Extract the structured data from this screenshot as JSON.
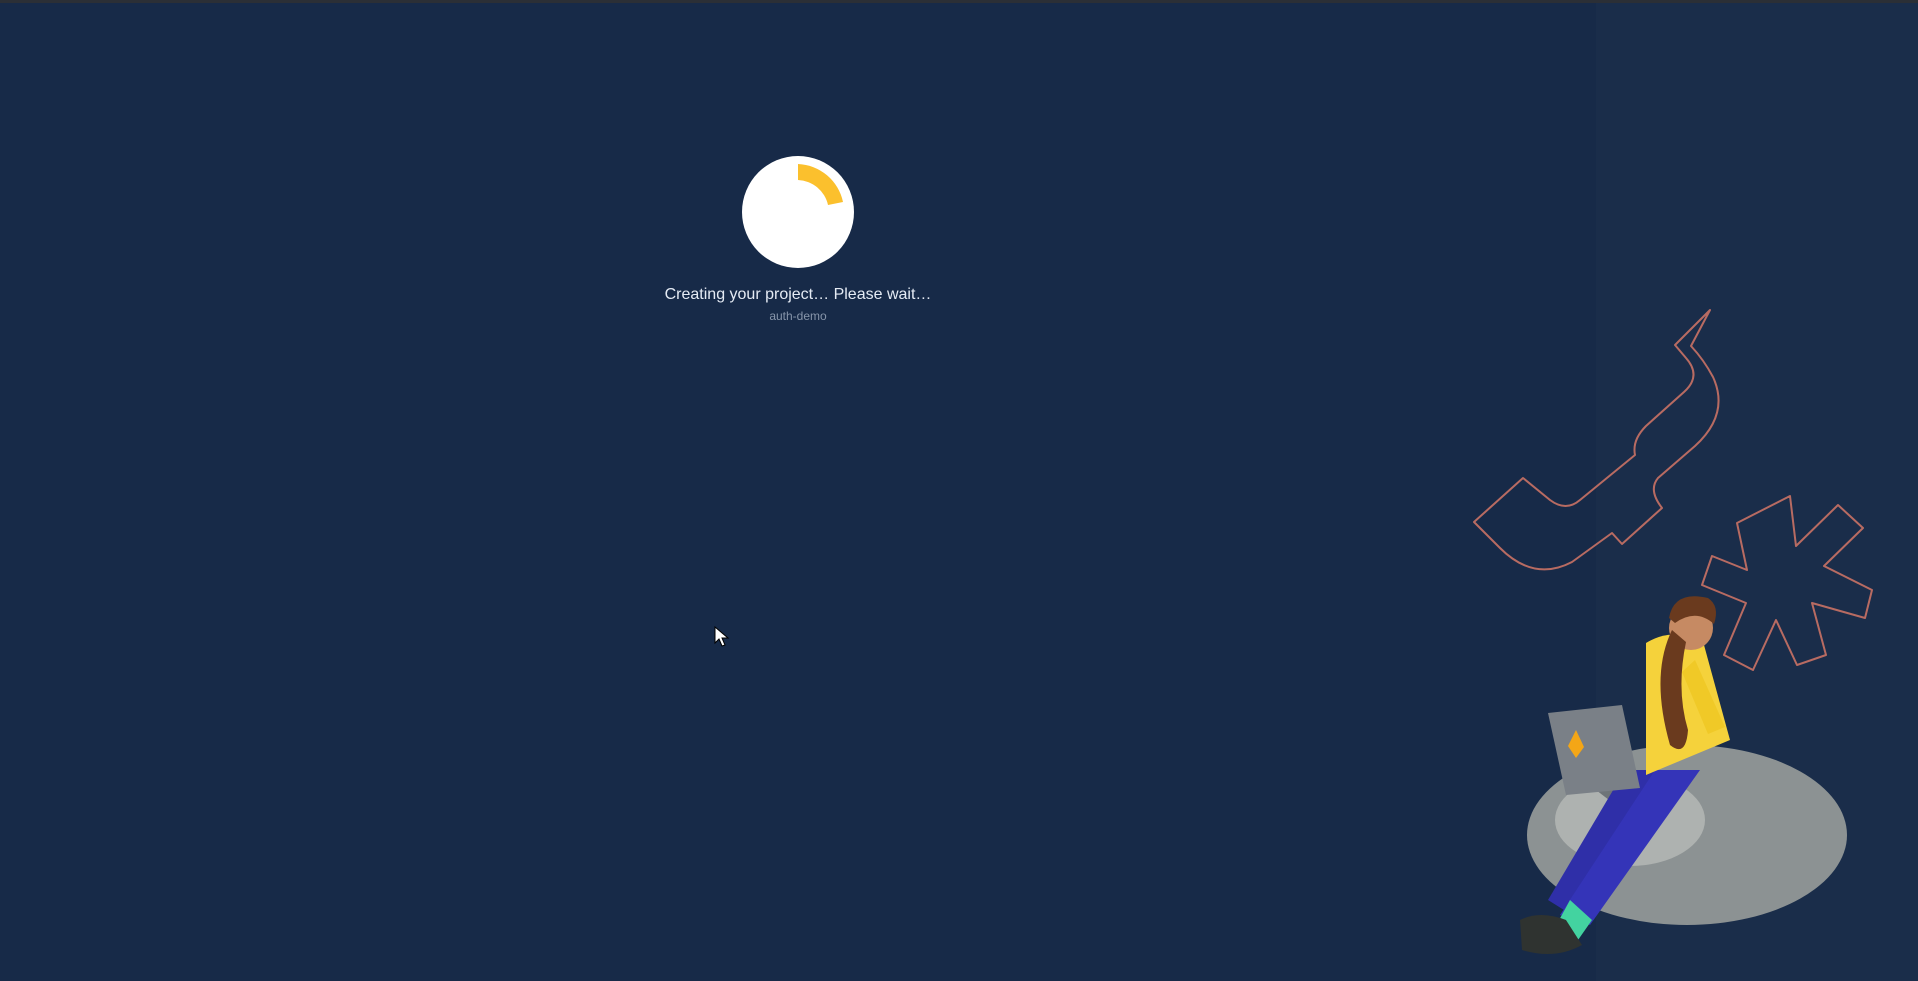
{
  "status": {
    "message": "Creating your project… Please wait…",
    "project_id": "auth-demo",
    "progress_fraction": 0.12
  },
  "colors": {
    "background": "#172a48",
    "spinner_circle": "#ffffff",
    "spinner_accent": "#fbc02d",
    "illustration_outline": "#b86b62"
  },
  "icons": {
    "spinner": "loading-spinner-icon",
    "cursor": "mouse-pointer-icon",
    "illustration": "person-with-laptop-illustration"
  }
}
